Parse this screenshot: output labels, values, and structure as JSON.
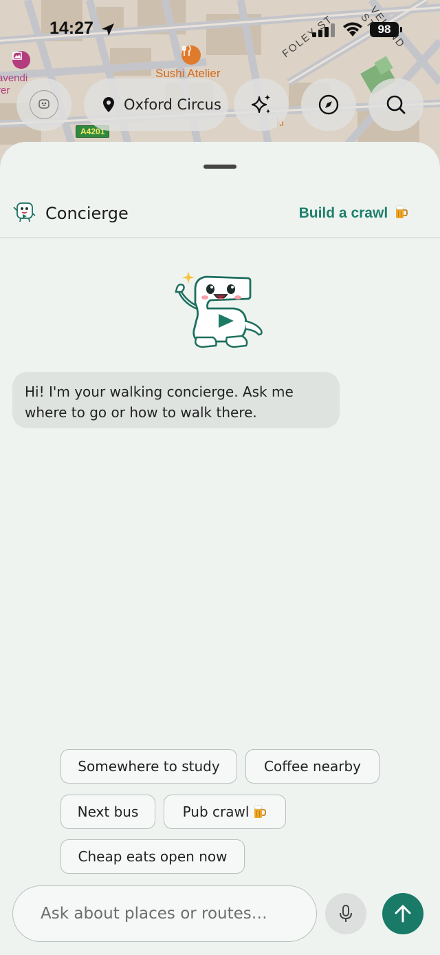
{
  "status_bar": {
    "time": "14:27",
    "battery": "98"
  },
  "map": {
    "labels": {
      "sushi": "Sushi Atelier",
      "foley": "FOLEY ST",
      "cleveland": "VELAND ST",
      "cavendish": "avendi\nrer",
      "aki": "ki"
    },
    "road_badge": "A4201"
  },
  "controls": {
    "location": "Oxford Circus",
    "icons": [
      "mascot-avatar-icon",
      "location-pin-icon",
      "sparkles-icon",
      "compass-icon",
      "search-icon"
    ]
  },
  "header": {
    "title": "Concierge",
    "action_label": "Build a crawl"
  },
  "chat": {
    "messages": [
      {
        "role": "assistant",
        "text": "Hi! I'm your walking concierge. Ask me where to go or how to walk there."
      }
    ]
  },
  "suggestions": [
    {
      "label": "Somewhere to study"
    },
    {
      "label": "Coffee nearby"
    },
    {
      "label": "Next bus"
    },
    {
      "label": "Pub crawl"
    },
    {
      "label": "Cheap eats open now"
    }
  ],
  "composer": {
    "placeholder": "Ask about places or routes…"
  },
  "colors": {
    "accent": "#187a67",
    "accent_text": "#1e7f6b",
    "sheet_bg": "#eef3f0",
    "bubble_bg": "#dee3e0"
  }
}
